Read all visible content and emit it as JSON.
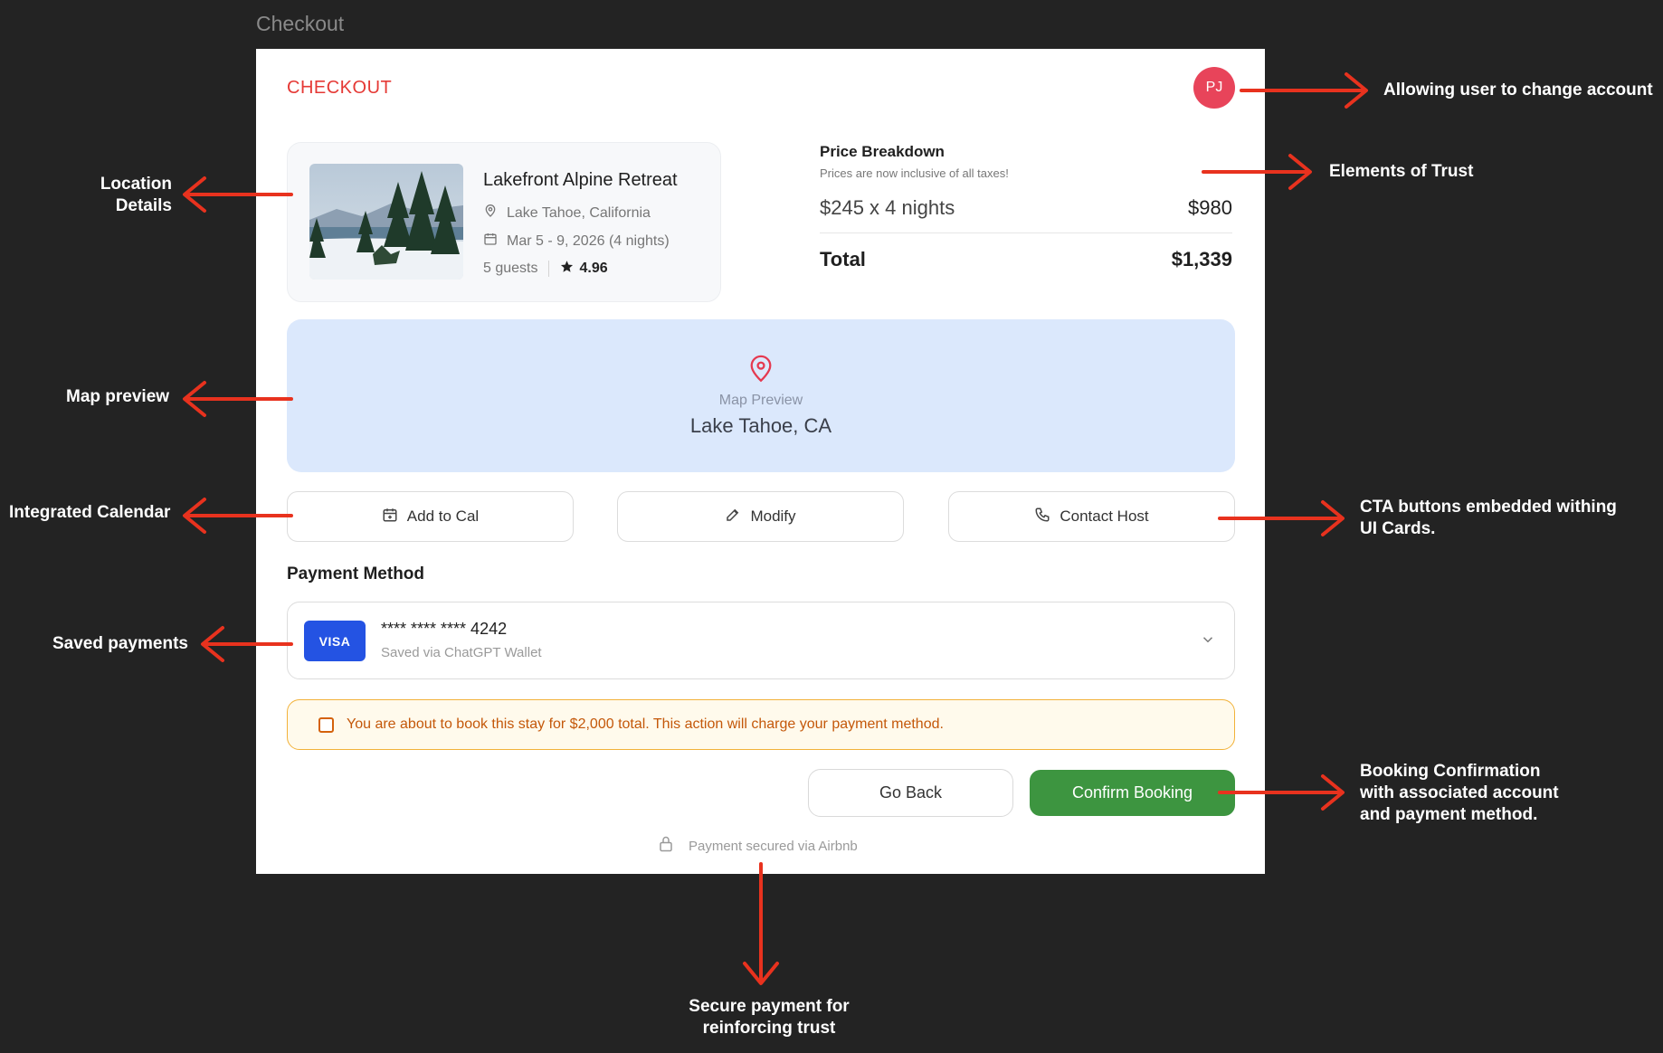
{
  "frame": {
    "title": "Checkout"
  },
  "header": {
    "title": "CHECKOUT",
    "avatar_initials": "PJ"
  },
  "listing": {
    "name": "Lakefront Alpine Retreat",
    "location": "Lake Tahoe, California",
    "dates": "Mar 5 - 9, 2026 (4 nights)",
    "guests": "5 guests",
    "rating": "4.96"
  },
  "price": {
    "title": "Price Breakdown",
    "subtitle": "Prices are now inclusive of all taxes!",
    "line_label": "$245 x 4 nights",
    "line_amount": "$980",
    "total_label": "Total",
    "total_amount": "$1,339"
  },
  "map": {
    "label": "Map Preview",
    "place": "Lake Tahoe, CA"
  },
  "actions": {
    "add_to_cal": "Add to Cal",
    "modify": "Modify",
    "contact_host": "Contact Host"
  },
  "payment": {
    "title": "Payment Method",
    "brand": "VISA",
    "number": "**** **** **** 4242",
    "saved_via": "Saved via ChatGPT Wallet"
  },
  "warning": {
    "text": "You are about to book this stay for $2,000 total. This action will charge your payment method."
  },
  "buttons": {
    "go_back": "Go Back",
    "confirm": "Confirm Booking"
  },
  "secure": {
    "text": "Payment secured via Airbnb"
  },
  "annotations": {
    "account": "Allowing user to change account",
    "trust": "Elements of Trust",
    "location_1": "Location",
    "location_2": "Details",
    "map": "Map preview",
    "calendar": "Integrated Calendar",
    "cta_1": "CTA buttons embedded withing",
    "cta_2": "UI Cards.",
    "saved": "Saved payments",
    "confirm_1": "Booking Confirmation",
    "confirm_2": "with associated account",
    "confirm_3": "and payment method.",
    "secure_1": "Secure payment for",
    "secure_2": "reinforcing trust"
  },
  "colors": {
    "accent_red": "#e53935",
    "avatar": "#e8445a",
    "confirm_green": "#3d9540",
    "map_bg": "#dbe8fc",
    "visa_blue": "#2453e3",
    "warning_border": "#f2b23a",
    "annotation_arrow": "#e8321e"
  }
}
